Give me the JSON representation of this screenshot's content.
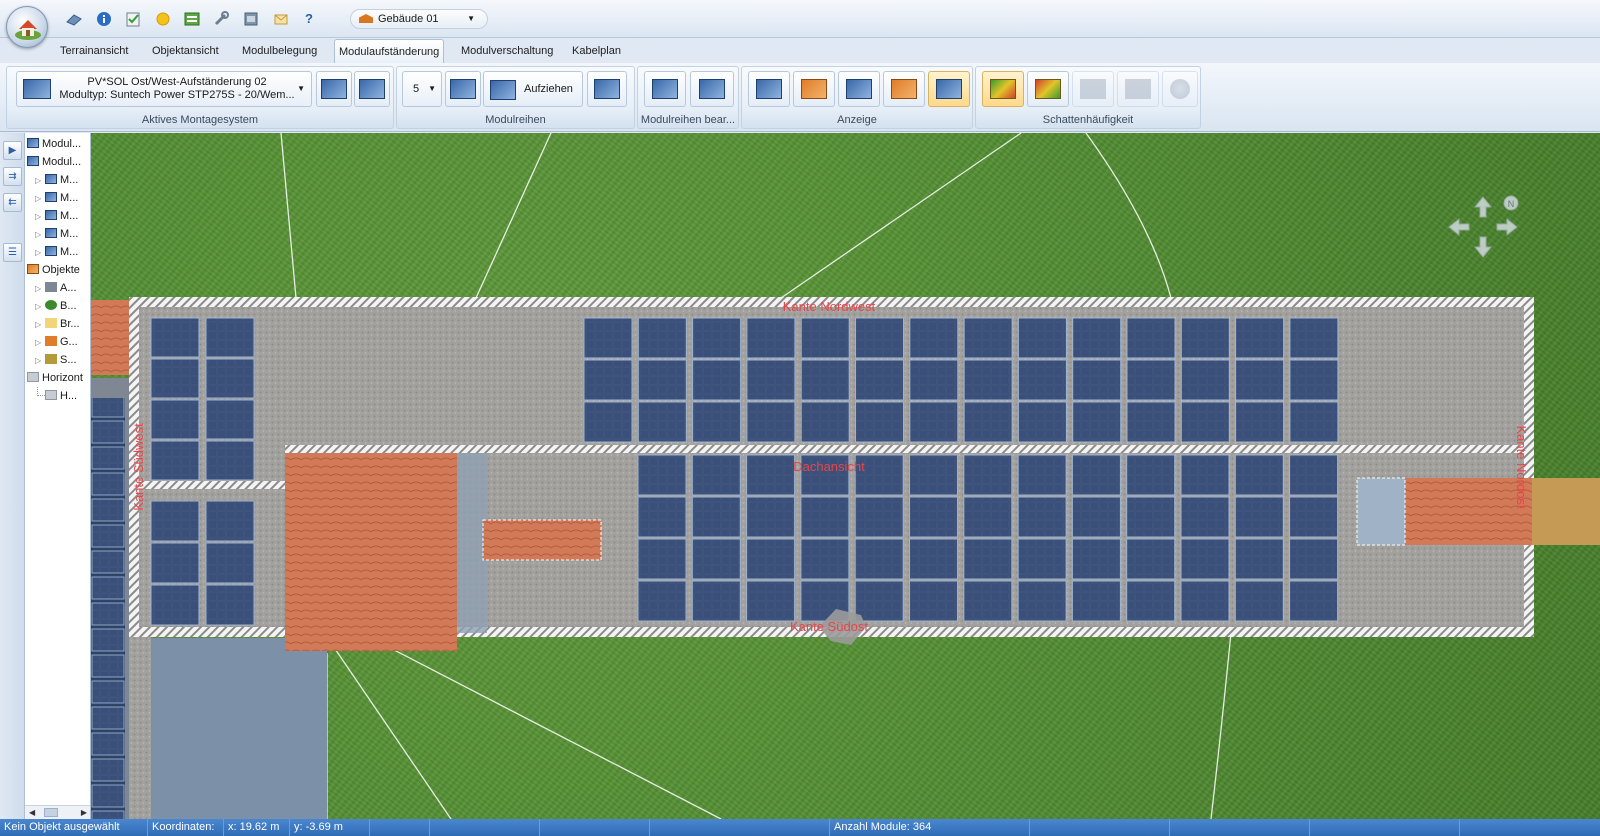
{
  "quickbar": {
    "icons": [
      "new-project-icon",
      "info-icon",
      "checklist-icon",
      "sun-icon",
      "climate-data-icon",
      "tools-icon",
      "database-icon",
      "email-icon",
      "help-icon"
    ],
    "help_label": "?",
    "building": "Gebäude 01"
  },
  "tabs": [
    {
      "label": "Terrainansicht"
    },
    {
      "label": "Objektansicht"
    },
    {
      "label": "Modulbelegung"
    },
    {
      "label": "Modulaufständerung",
      "active": true
    },
    {
      "label": "Modulverschaltung"
    },
    {
      "label": "Kabelplan"
    }
  ],
  "ribbon": {
    "montage": {
      "line1": "PV*SOL Ost/West-Aufständerung 02",
      "line2": "Modultyp: Suntech Power STP275S - 20/Wem...",
      "group_label": "Aktives Montagesystem"
    },
    "modulreihen": {
      "count": "5",
      "pull_label": "Aufziehen",
      "group_label": "Modulreihen"
    },
    "edit": {
      "group_label": "Modulreihen bear..."
    },
    "anzeige": {
      "group_label": "Anzeige"
    },
    "schatten": {
      "group_label": "Schattenhäufigkeit"
    }
  },
  "tree": {
    "root1": "Modul...",
    "root2": "Modul...",
    "module_items": [
      "M...",
      "M...",
      "M...",
      "M...",
      "M..."
    ],
    "objects_label": "Objekte",
    "object_items": [
      "A...",
      "B...",
      "Br...",
      "G...",
      "S..."
    ],
    "horizon_label": "Horizont",
    "horizon_item": "H..."
  },
  "viewport": {
    "label_north": "Kante Nordwest",
    "label_south": "Kante Südost",
    "label_west": "Kante Südwest",
    "label_east": "Kante Nordost",
    "label_roof": "Dachansicht",
    "compass_north": "N"
  },
  "status": {
    "selection": "Kein Objekt ausgewählt",
    "coords_label": "Koordinaten:",
    "x": "x: 19.62 m",
    "y": "y: -3.69 m",
    "modules": "Anzahl Module:  364"
  },
  "colors": {
    "statusbar": "#2f6cb6",
    "grass": "#4f8a30",
    "label_red": "#e8454a",
    "panel_blue": "#2f4366",
    "roof_tile": "#d9805f"
  }
}
